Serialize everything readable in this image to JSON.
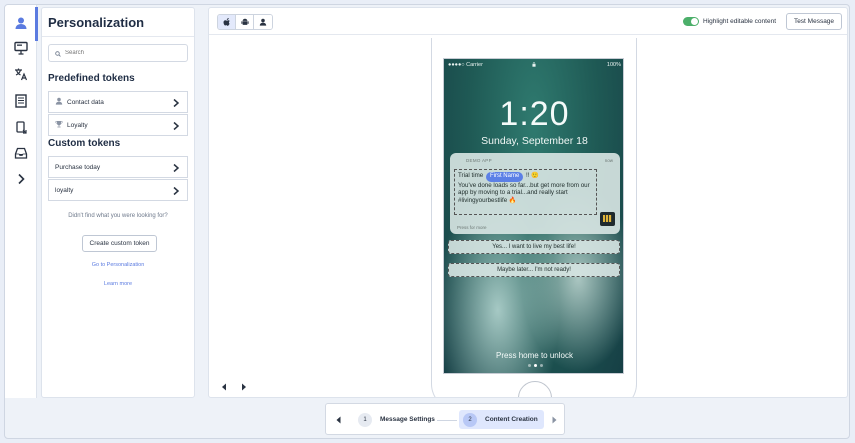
{
  "sidebar": {
    "title": "Personalization",
    "search_placeholder": "Search",
    "predefined_heading": "Predefined tokens",
    "predefined_tokens": [
      {
        "label": "Contact data",
        "icon": "person-icon"
      },
      {
        "label": "Loyalty",
        "icon": "trophy-icon"
      }
    ],
    "custom_heading": "Custom tokens",
    "custom_tokens": [
      {
        "label": "Purchase today"
      },
      {
        "label": "loyalty"
      }
    ],
    "help_text": "Didn't find what you were looking for?",
    "create_button": "Create custom token",
    "go_link": "Go to Personalization",
    "learn_link": "Learn more"
  },
  "rail": {
    "icons": [
      "person-icon",
      "presentation-icon",
      "translate-icon",
      "document-icon",
      "mobile-device-icon",
      "inbox-icon",
      "chevron-right-icon"
    ],
    "active_index": 0,
    "accent": "#5b7be0"
  },
  "toolbar": {
    "platforms": [
      "apple-icon",
      "android-icon",
      "user-icon"
    ],
    "active_platform": 0,
    "highlight_label": "Highlight editable content",
    "highlight_on": true,
    "test_button": "Test Message",
    "toggle_color": "#4caf6a"
  },
  "phone": {
    "status_left": "●●●●○ Carrier",
    "status_right": "100%",
    "time": "1:20",
    "date": "Sunday, September 18",
    "notification": {
      "app": "DEMO APP",
      "when": "now",
      "line1_prefix": "Trial time",
      "token": "First Name",
      "line1_suffix": "!! 🙂",
      "body": "You've done loads so far...but get more from our app by moving to a trial...and really start #livingyourbestlife 🔥",
      "press_hint": "Press for more"
    },
    "actions": [
      "Yes... I want to live my best life!",
      "Maybe later... I'm not ready!"
    ],
    "unlock": "Press home to unlock"
  },
  "stepper": {
    "steps": [
      {
        "num": "1",
        "label": "Message Settings"
      },
      {
        "num": "2",
        "label": "Content Creation"
      }
    ],
    "active": 1,
    "accent": "#dfe7fd"
  }
}
